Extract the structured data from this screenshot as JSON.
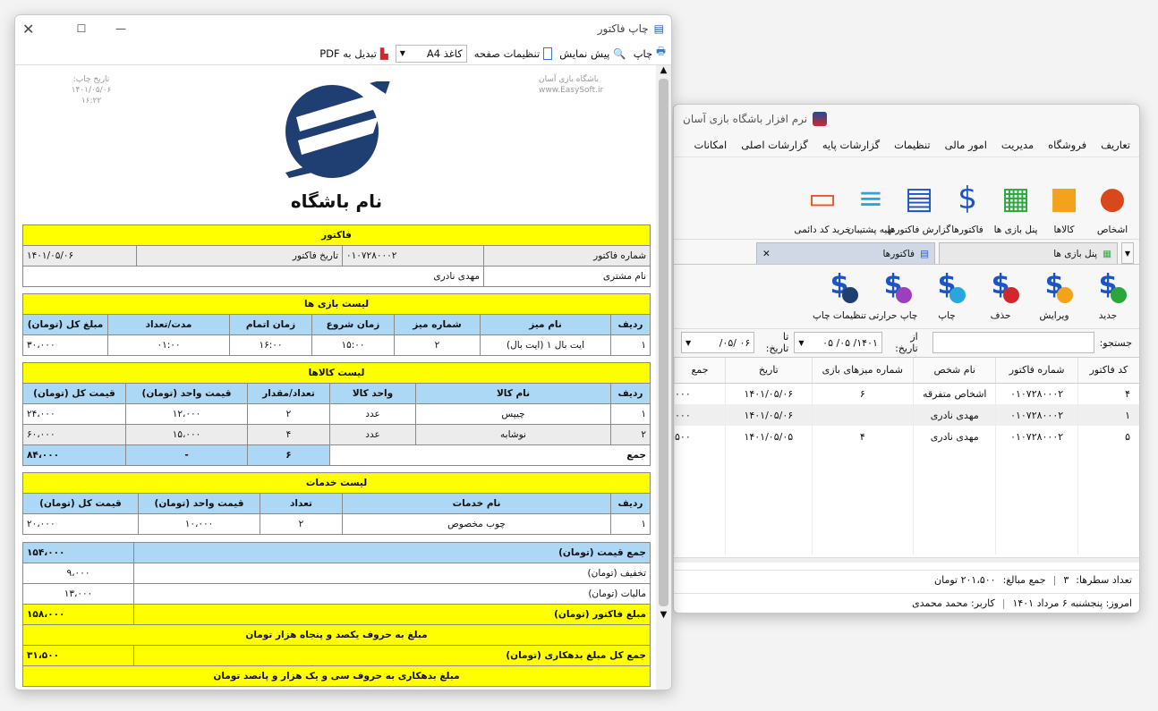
{
  "main": {
    "title": "نرم افزار باشگاه بازی آسان",
    "menu": [
      "تعاریف",
      "فروشگاه",
      "مدیریت",
      "امور مالی",
      "تنظیمات",
      "گزارشات پایه",
      "گزارشات اصلی",
      "امکانات"
    ],
    "ribbon": [
      {
        "label": "اشخاص",
        "icon": "person-icon"
      },
      {
        "label": "کالاها",
        "icon": "box-icon"
      },
      {
        "label": "پنل بازی ها",
        "icon": "table-icon"
      },
      {
        "label": "فاکتورها",
        "icon": "invoice-icon"
      },
      {
        "label": "گزارش فاکتورها",
        "icon": "report-chart-icon"
      },
      {
        "label": "تهیه پشتیبان",
        "icon": "database-icon"
      },
      {
        "label": "خرید کد دائمی",
        "icon": "credit-card-icon"
      }
    ],
    "tabs": [
      {
        "label": "پنل بازی ها"
      },
      {
        "label": "فاکتورها"
      }
    ],
    "actions": [
      {
        "label": "جدید",
        "icon": "invoice-add-icon"
      },
      {
        "label": "ویرایش",
        "icon": "invoice-edit-icon"
      },
      {
        "label": "حذف",
        "icon": "invoice-delete-icon"
      },
      {
        "label": "چاپ",
        "icon": "invoice-print-icon"
      },
      {
        "label": "چاپ حرارتی",
        "icon": "invoice-thermal-print-icon"
      },
      {
        "label": "تنظیمات چاپ",
        "icon": "invoice-settings-icon"
      }
    ],
    "search_label": "جستجو:",
    "from_label": "از تاریخ:",
    "from_date": "۱۴۰۱/ ۰۵/ ۰۵",
    "to_label": "تا تاریخ:",
    "to_date": "۰۶ /۰۵/",
    "columns": [
      "کد فاکتور",
      "شماره فاکتور",
      "نام شخص",
      "شماره میزهای بازی",
      "تاریخ",
      "جمع"
    ],
    "rows": [
      [
        "۴",
        "۰۱۰۷۲۸۰۰۰۲",
        "اشخاص متفرقه",
        "۶",
        "۱۴۰۱/۰۵/۰۶",
        "۰۰۰"
      ],
      [
        "۱",
        "۰۱۰۷۲۸۰۰۰۲",
        "مهدی نادری",
        "",
        "۱۴۰۱/۰۵/۰۶",
        "۰۰۰"
      ],
      [
        "۵",
        "۰۱۰۷۲۸۰۰۰۲",
        "مهدی نادری",
        "۴",
        "۱۴۰۱/۰۵/۰۵",
        "۵۰۰"
      ]
    ],
    "row_count_label": "تعداد سطرها:",
    "row_count": "۳",
    "sum_label": "جمع مبالغ:",
    "sum_value": "۲۰۱،۵۰۰ تومان",
    "today_label": "امروز: پنجشنبه ۶ مرداد ۱۴۰۱",
    "user_label": "کاربر: محمد محمدی"
  },
  "print": {
    "title": "چاپ فاکتور",
    "print_btn": "چاپ",
    "preview_btn": "پیش نمایش",
    "page_settings_btn": "تنظیمات صفحه",
    "paper_value": "کاغذ A4",
    "pdf_btn": "تبدیل به PDF",
    "print_date_label": "تاریخ چاپ:",
    "print_date": "۱۴۰۱/۰۵/۰۶",
    "print_time": "۱۶:۲۲",
    "brand_line": "باشگاه بازی آسان",
    "brand_url": "www.EasySoft.ir",
    "club_name": "نام باشگاه",
    "invoice_header": "فاکتور",
    "invoice_no_label": "شماره فاکتور",
    "invoice_no": "۰۱۰۷۲۸۰۰۰۲",
    "invoice_date_label": "تاریخ فاکتور",
    "invoice_date": "۱۴۰۱/۰۵/۰۶",
    "customer_label": "نام مشتری",
    "customer": "مهدی نادری",
    "games_header": "لیست بازی ها",
    "games_cols": [
      "ردیف",
      "نام میز",
      "شماره میز",
      "زمان شروع",
      "زمان اتمام",
      "مدت/تعداد",
      "مبلغ کل (تومان)"
    ],
    "games_rows": [
      [
        "۱",
        "ایت بال ۱ (ایت بال)",
        "۲",
        "۱۵:۰۰",
        "۱۶:۰۰",
        "۰۱:۰۰",
        "۳۰،۰۰۰"
      ]
    ],
    "goods_header": "لیست کالاها",
    "goods_cols": [
      "ردیف",
      "نام کالا",
      "واحد کالا",
      "تعداد/مقدار",
      "قیمت واحد (تومان)",
      "قیمت کل (تومان)"
    ],
    "goods_rows": [
      [
        "۱",
        "چیپس",
        "عدد",
        "۲",
        "۱۲،۰۰۰",
        "۲۴،۰۰۰"
      ],
      [
        "۲",
        "نوشابه",
        "عدد",
        "۴",
        "۱۵،۰۰۰",
        "۶۰،۰۰۰"
      ]
    ],
    "goods_sum": [
      "جمع",
      "۶",
      "-",
      "۸۴،۰۰۰"
    ],
    "services_header": "لیست خدمات",
    "services_cols": [
      "ردیف",
      "نام خدمات",
      "تعداد",
      "قیمت واحد (تومان)",
      "قیمت کل (تومان)"
    ],
    "services_rows": [
      [
        "۱",
        "چوب مخصوص",
        "۲",
        "۱۰،۰۰۰",
        "۲۰،۰۰۰"
      ]
    ],
    "total_label": "جمع قیمت (تومان)",
    "total": "۱۵۴،۰۰۰",
    "discount_label": "تخفیف (تومان)",
    "discount": "۹،۰۰۰",
    "tax_label": "مالیات (تومان)",
    "tax": "۱۳،۰۰۰",
    "invoice_amount_label": "مبلغ فاکتور (تومان)",
    "invoice_amount": "۱۵۸،۰۰۰",
    "amount_words": "مبلغ به حروف یکصد و پنجاه هزار تومان",
    "debt_label": "جمع کل مبلغ بدهکاری (تومان)",
    "debt": "۳۱،۵۰۰",
    "debt_words": "مبلغ بدهکاری به حروف سی و یک هزار و پانصد تومان"
  }
}
